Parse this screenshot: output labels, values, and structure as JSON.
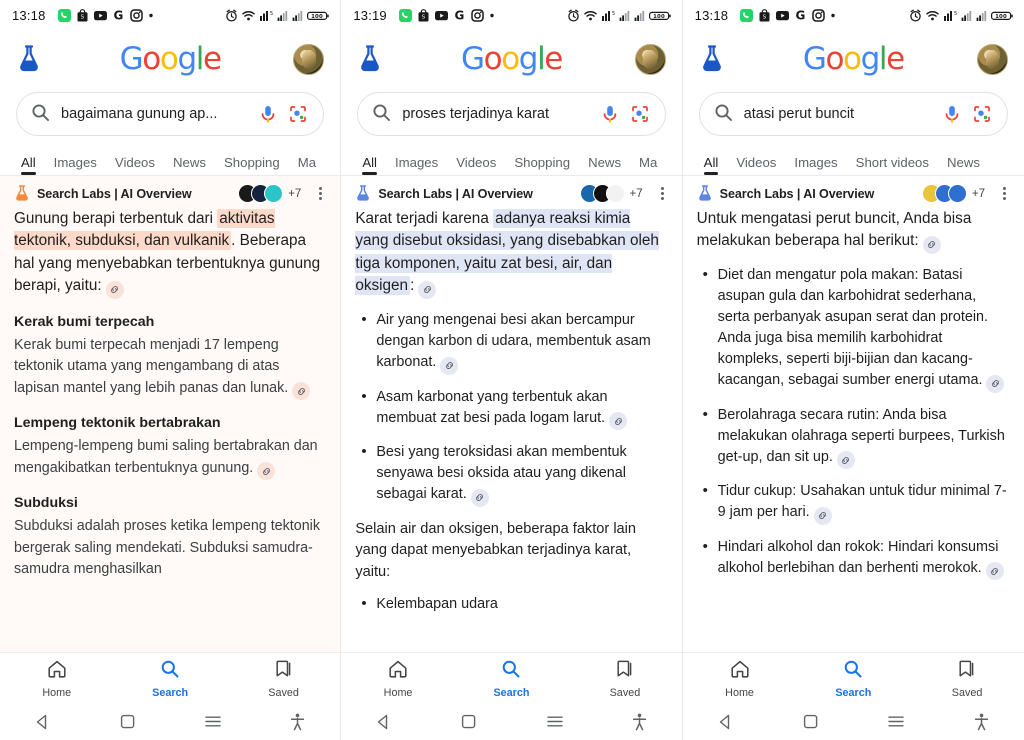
{
  "device": {
    "status_bar": {
      "time_a": "13:18",
      "time_b": "13:19",
      "battery_level": "100",
      "left_icons": [
        "whatsapp-icon",
        "shopping-bag-icon",
        "youtube-icon",
        "google-g-icon",
        "instagram-icon",
        "dot-icon"
      ],
      "right_icons": [
        "alarm-icon",
        "wifi-icon",
        "mobile-data-icon",
        "signal-1-icon",
        "signal-2-icon",
        "battery-icon"
      ]
    },
    "bottom_nav": [
      {
        "label": "Home",
        "icon": "home-icon",
        "active": false
      },
      {
        "label": "Search",
        "icon": "search-icon",
        "active": true
      },
      {
        "label": "Saved",
        "icon": "bookmark-icon",
        "active": false
      }
    ],
    "system_nav": [
      "back-triangle-icon",
      "home-square-icon",
      "recents-hamburger-icon",
      "accessibility-icon"
    ],
    "accent_blue": "#1a73e8"
  },
  "brand": {
    "logo_letters": [
      "G",
      "o",
      "o",
      "g",
      "l",
      "e"
    ],
    "labs_flask_icon": "labs-flask-icon",
    "avatar_icon": "user-avatar"
  },
  "ai_overview_common": {
    "title": "Search Labs | AI Overview",
    "sources_more": "+7",
    "kebab_icon": "more-options-icon",
    "link_icon": "link-chip-icon"
  },
  "panels": [
    {
      "id": "panel-volcano",
      "time": "13:18",
      "query": "bagaimana gunung ap...",
      "tabs": [
        {
          "label": "All",
          "active": true
        },
        {
          "label": "Images",
          "active": false
        },
        {
          "label": "Videos",
          "active": false
        },
        {
          "label": "News",
          "active": false
        },
        {
          "label": "Shopping",
          "active": false
        },
        {
          "label": "Ma",
          "active": false
        }
      ],
      "highlight_color": "#fcd9c8",
      "tint": true,
      "source_avatars": [
        "#1a1a1a",
        "#16233f",
        "#2bc4c9"
      ],
      "lead": {
        "pre": "Gunung berapi terbentuk dari ",
        "highlight": "aktivitas tektonik, subduksi, dan vulkanik",
        "post": ". Beberapa hal yang menyebabkan terbentuknya gunung berapi, yaitu:"
      },
      "sections": [
        {
          "heading": "Kerak bumi terpecah",
          "text": "Kerak bumi terpecah menjadi 17 lempeng tektonik utama yang mengambang di atas lapisan mantel yang lebih panas dan lunak."
        },
        {
          "heading": "Lempeng tektonik bertabrakan",
          "text": "Lempeng-lempeng bumi saling bertabrakan dan mengakibatkan terbentuknya gunung."
        },
        {
          "heading": "Subduksi",
          "text": "Subduksi adalah proses ketika lempeng tektonik bergerak saling mendekati. Subduksi samudra-samudra menghasilkan",
          "no_link": true
        }
      ]
    },
    {
      "id": "panel-rust",
      "time": "13:19",
      "query": "proses terjadinya karat",
      "tabs": [
        {
          "label": "All",
          "active": true
        },
        {
          "label": "Images",
          "active": false
        },
        {
          "label": "Videos",
          "active": false
        },
        {
          "label": "Shopping",
          "active": false
        },
        {
          "label": "News",
          "active": false
        },
        {
          "label": "Ma",
          "active": false
        }
      ],
      "highlight_color": "#dfe5f5",
      "tint": false,
      "source_avatars": [
        "#1966ab",
        "#101010",
        "#f2f2f2"
      ],
      "lead": {
        "pre": "Karat terjadi karena ",
        "highlight": "adanya reaksi kimia yang disebut oksidasi, yang disebabkan oleh tiga komponen, yaitu zat besi, air, dan oksigen",
        "post": ":"
      },
      "bullets": [
        "Air yang mengenai besi akan bercampur dengan karbon di udara, membentuk asam karbonat.",
        "Asam karbonat yang terbentuk akan membuat zat besi pada logam larut.",
        "Besi yang teroksidasi akan membentuk senyawa besi oksida atau yang dikenal sebagai karat."
      ],
      "closing_para": "Selain air dan oksigen, beberapa faktor lain yang dapat menyebabkan terjadinya karat, yaitu:",
      "closing_bullets": [
        "Kelembapan udara"
      ]
    },
    {
      "id": "panel-belly",
      "time": "13:18",
      "query": "atasi perut buncit",
      "tabs": [
        {
          "label": "All",
          "active": true
        },
        {
          "label": "Videos",
          "active": false
        },
        {
          "label": "Images",
          "active": false
        },
        {
          "label": "Short videos",
          "active": false
        },
        {
          "label": "News",
          "active": false
        }
      ],
      "highlight_color": "",
      "tint": false,
      "source_avatars": [
        "#e8c53a",
        "#2f6fd0",
        "#2f6fd0"
      ],
      "lead": {
        "pre": "Untuk mengatasi perut buncit, Anda bisa melakukan beberapa hal berikut:",
        "highlight": "",
        "post": ""
      },
      "bullets": [
        "Diet dan mengatur pola makan: Batasi asupan gula dan karbohidrat sederhana, serta perbanyak asupan serat dan protein. Anda juga bisa memilih karbohidrat kompleks, seperti biji-bijian dan kacang-kacangan, sebagai sumber energi utama.",
        "Berolahraga secara rutin: Anda bisa melakukan olahraga seperti burpees, Turkish get-up, dan sit up.",
        "Tidur cukup: Usahakan untuk tidur minimal 7-9 jam per hari.",
        "Hindari alkohol dan rokok: Hindari konsumsi alkohol berlebihan dan berhenti merokok."
      ]
    }
  ]
}
